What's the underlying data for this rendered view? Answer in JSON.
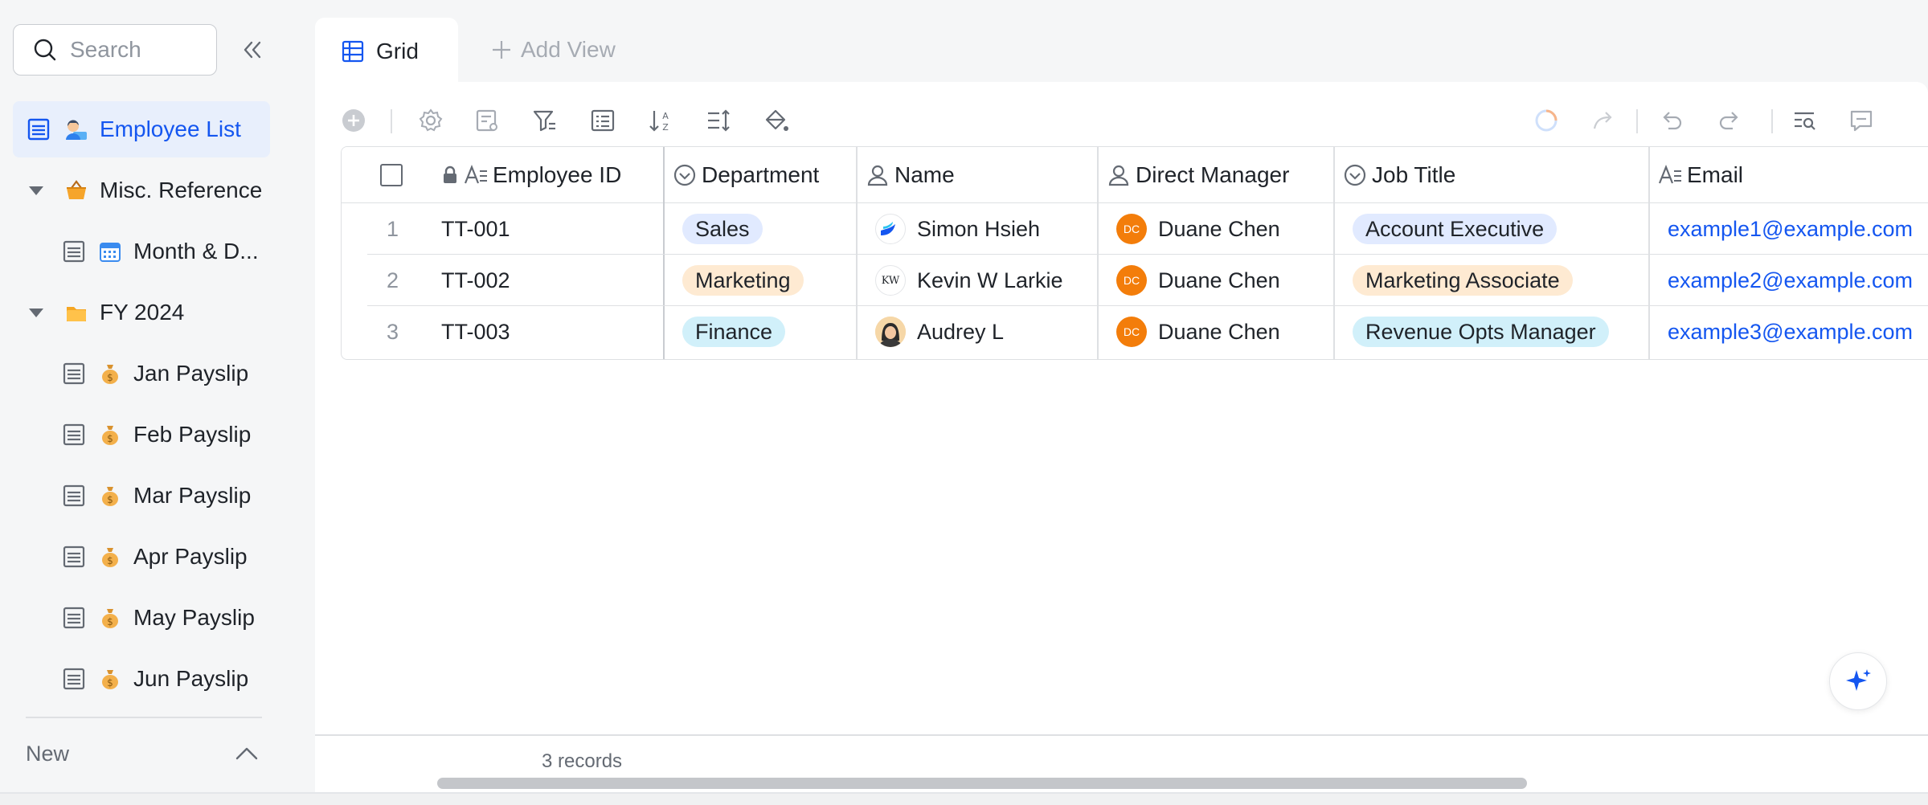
{
  "sidebar": {
    "search_placeholder": "Search",
    "items": [
      {
        "label": "Employee List",
        "active": true
      },
      {
        "label": "Misc. Reference",
        "folder": true
      },
      {
        "label": "Month & D..."
      },
      {
        "label": "FY 2024",
        "folder": true
      },
      {
        "label": "Jan Payslip"
      },
      {
        "label": "Feb Payslip"
      },
      {
        "label": "Mar Payslip"
      },
      {
        "label": "Apr Payslip"
      },
      {
        "label": "May Payslip"
      },
      {
        "label": "Jun Payslip"
      }
    ],
    "new_label": "New"
  },
  "tabs": {
    "grid_label": "Grid",
    "add_view_label": "Add View"
  },
  "grid": {
    "columns": [
      "Employee ID",
      "Department",
      "Name",
      "Direct Manager",
      "Job Title",
      "Email"
    ],
    "rows": [
      {
        "num": "1",
        "id": "TT-001",
        "department": "Sales",
        "name": "Simon Hsieh",
        "manager": "Duane Chen",
        "manager_initials": "DC",
        "job": "Account Executive",
        "email": "example1@example.com"
      },
      {
        "num": "2",
        "id": "TT-002",
        "department": "Marketing",
        "name": "Kevin W Larkie",
        "name_initials": "KW",
        "manager": "Duane Chen",
        "manager_initials": "DC",
        "job": "Marketing Associate",
        "email": "example2@example.com"
      },
      {
        "num": "3",
        "id": "TT-003",
        "department": "Finance",
        "name": "Audrey L",
        "manager": "Duane Chen",
        "manager_initials": "DC",
        "job": "Revenue Opts Manager",
        "email": "example3@example.com"
      }
    ]
  },
  "footer": {
    "records": "3 records"
  },
  "colors": {
    "accent": "#1456f0",
    "active_bg": "#e8effc",
    "tag_blue": "#e1eaff",
    "tag_orange": "#feead2",
    "tag_cyan": "#d1f0fa",
    "manager_avatar": "#f37d0a"
  }
}
